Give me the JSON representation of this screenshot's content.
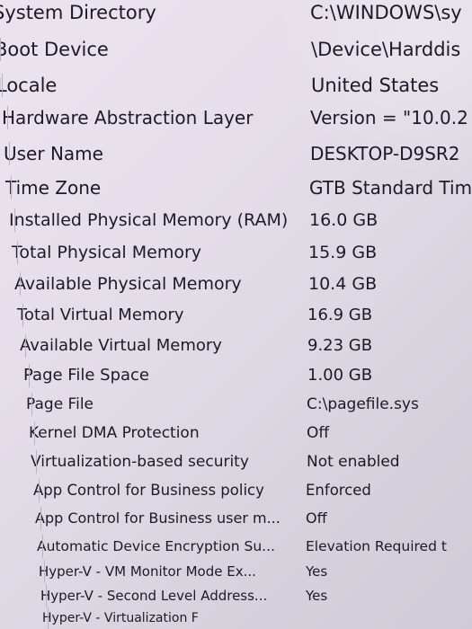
{
  "rows": [
    {
      "item": "System Directory",
      "value": "C:\\WINDOWS\\sy"
    },
    {
      "item": "Boot Device",
      "value": "\\Device\\Harddis"
    },
    {
      "item": "Locale",
      "value": "United States"
    },
    {
      "item": "Hardware Abstraction Layer",
      "value": "Version = \"10.0.2"
    },
    {
      "item": "User Name",
      "value": "DESKTOP-D9SR2"
    },
    {
      "item": "Time Zone",
      "value": "GTB Standard Tim"
    },
    {
      "item": "Installed Physical Memory (RAM)",
      "value": "16.0 GB"
    },
    {
      "item": "Total Physical Memory",
      "value": "15.9 GB"
    },
    {
      "item": "Available Physical Memory",
      "value": "10.4 GB"
    },
    {
      "item": "Total Virtual Memory",
      "value": "16.9 GB"
    },
    {
      "item": "Available Virtual Memory",
      "value": "9.23 GB"
    },
    {
      "item": "Page File Space",
      "value": "1.00 GB"
    },
    {
      "item": "Page File",
      "value": "C:\\pagefile.sys"
    },
    {
      "item": "Kernel DMA Protection",
      "value": "Off"
    },
    {
      "item": "Virtualization-based security",
      "value": "Not enabled"
    },
    {
      "item": "App Control for Business policy",
      "value": "Enforced"
    },
    {
      "item": "App Control for Business user m...",
      "value": "Off"
    },
    {
      "item": "Automatic Device Encryption Su...",
      "value": "Elevation Required t"
    },
    {
      "item": "Hyper-V - VM Monitor Mode Ex...",
      "value": "Yes"
    },
    {
      "item": "Hyper-V - Second Level Address...",
      "value": "Yes"
    },
    {
      "item": "Hyper-V - Virtualization F",
      "value": ""
    }
  ]
}
